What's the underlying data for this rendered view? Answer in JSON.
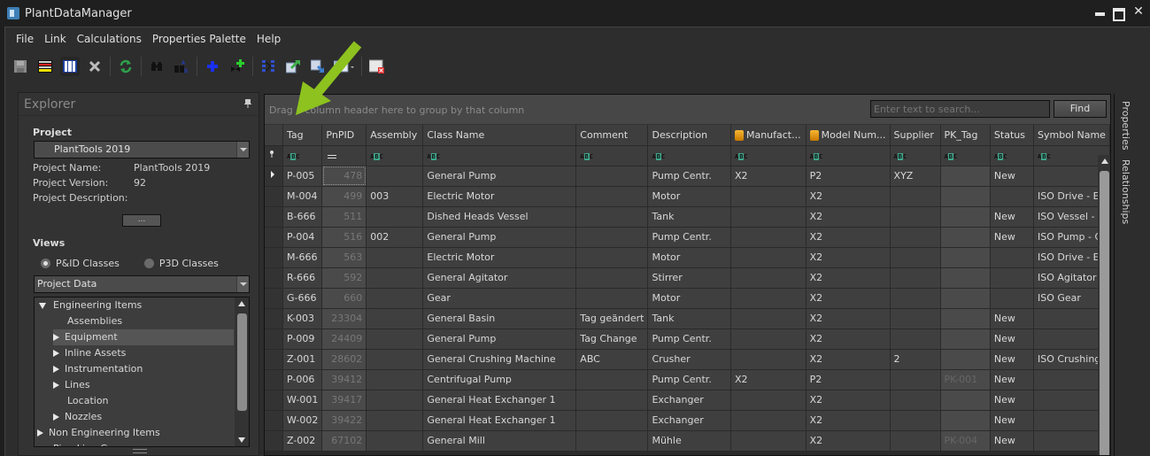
{
  "window": {
    "title": "PlantDataManager",
    "controls": [
      "minimize",
      "maximize",
      "close"
    ]
  },
  "menu": [
    "File",
    "Link",
    "Calculations",
    "Properties Palette",
    "Help"
  ],
  "toolbar": [
    {
      "name": "save-icon",
      "enabled": false
    },
    {
      "name": "color-rows-icon"
    },
    {
      "name": "columns-icon",
      "active": true
    },
    {
      "name": "delete-icon"
    },
    {
      "sep": true
    },
    {
      "name": "refresh-icon"
    },
    {
      "sep": true
    },
    {
      "name": "find-icon"
    },
    {
      "name": "find-replace-icon"
    },
    {
      "sep": true
    },
    {
      "name": "add-icon"
    },
    {
      "name": "add-valve-icon"
    },
    {
      "sep": true
    },
    {
      "name": "link-icon"
    },
    {
      "name": "export-icon"
    },
    {
      "name": "import-icon"
    },
    {
      "name": "table-view-dropdown-icon"
    },
    {
      "sep": true
    },
    {
      "name": "close-project-icon"
    }
  ],
  "explorer": {
    "title": "Explorer",
    "project_label": "Project",
    "project_selected": "PlantTools 2019",
    "project_name_label": "Project Name:",
    "project_name": "PlantTools 2019",
    "project_version_label": "Project Version:",
    "project_version": "92",
    "project_description_label": "Project Description:",
    "project_description": "",
    "ellipsis_button": "...",
    "views_label": "Views",
    "views": [
      {
        "label": "P&ID Classes",
        "checked": true
      },
      {
        "label": "P3D Classes",
        "checked": false
      }
    ],
    "data_selected": "Project Data",
    "tree": [
      {
        "label": "Engineering Items",
        "level": 0,
        "expander": "expanded"
      },
      {
        "label": "Assemblies",
        "level": 1,
        "expander": "none"
      },
      {
        "label": "Equipment",
        "level": 1,
        "expander": "collapsed",
        "selected": true
      },
      {
        "label": "Inline Assets",
        "level": 1,
        "expander": "collapsed"
      },
      {
        "label": "Instrumentation",
        "level": 1,
        "expander": "collapsed"
      },
      {
        "label": "Lines",
        "level": 1,
        "expander": "collapsed"
      },
      {
        "label": "Location",
        "level": 1,
        "expander": "none"
      },
      {
        "label": "Nozzles",
        "level": 1,
        "expander": "collapsed"
      },
      {
        "label": "Non Engineering Items",
        "level": 0,
        "expander": "collapsed"
      },
      {
        "label": "Pipe Line Group",
        "level": 0,
        "expander": "none"
      }
    ]
  },
  "grid": {
    "group_hint": "Drag a column header here to group by that column",
    "search_placeholder": "Enter text to search...",
    "find_label": "Find",
    "columns": [
      "Tag",
      "PnPID",
      "Assembly",
      "Class Name",
      "Comment",
      "Description",
      "Manufact...",
      "Model Num...",
      "Supplier",
      "PK_Tag",
      "Status",
      "Symbol Name"
    ],
    "rows": [
      [
        "P-005",
        "478",
        "",
        "General Pump",
        "",
        "Pump Centr.",
        "X2",
        "P2",
        "XYZ",
        "",
        "New",
        ""
      ],
      [
        "M-004",
        "499",
        "003",
        "Electric Motor",
        "",
        "Motor",
        "",
        "X2",
        "",
        "",
        "",
        "ISO Drive - E"
      ],
      [
        "B-666",
        "511",
        "",
        "Dished Heads Vessel",
        "",
        "Tank",
        "",
        "X2",
        "",
        "",
        "New",
        "ISO Vessel -"
      ],
      [
        "P-004",
        "516",
        "002",
        "General Pump",
        "",
        "Pump Centr.",
        "",
        "X2",
        "",
        "",
        "New",
        "ISO Pump - C"
      ],
      [
        "M-666",
        "563",
        "",
        "Electric Motor",
        "",
        "Motor",
        "",
        "X2",
        "",
        "",
        "",
        "ISO Drive - E"
      ],
      [
        "R-666",
        "592",
        "",
        "General Agitator",
        "",
        "Stirrer",
        "",
        "X2",
        "",
        "",
        "",
        "ISO Agitator"
      ],
      [
        "G-666",
        "660",
        "",
        "Gear",
        "",
        "Motor",
        "",
        "X2",
        "",
        "",
        "",
        "ISO Gear"
      ],
      [
        "K-003",
        "23304",
        "",
        "General Basin",
        "Tag geändert",
        "Tank",
        "",
        "X2",
        "",
        "",
        "New",
        ""
      ],
      [
        "P-009",
        "24409",
        "",
        "General Pump",
        "Tag Change",
        "Pump Centr.",
        "",
        "X2",
        "",
        "",
        "New",
        ""
      ],
      [
        "Z-001",
        "28602",
        "",
        "General Crushing Machine",
        "ABC",
        "Crusher",
        "",
        "X2",
        "2",
        "",
        "New",
        "ISO Crushing"
      ],
      [
        "P-006",
        "39412",
        "",
        "Centrifugal Pump",
        "",
        "Pump Centr.",
        "X2",
        "P2",
        "",
        "PK-001",
        "New",
        ""
      ],
      [
        "W-001",
        "39417",
        "",
        "General Heat Exchanger 1",
        "",
        "Exchanger",
        "",
        "X2",
        "",
        "",
        "New",
        ""
      ],
      [
        "W-002",
        "39422",
        "",
        "General Heat Exchanger 1",
        "",
        "Exchanger",
        "",
        "X2",
        "",
        "",
        "New",
        ""
      ],
      [
        "Z-002",
        "67102",
        "",
        "General Mill",
        "",
        "Mühle",
        "",
        "X2",
        "",
        "PK-004",
        "New",
        ""
      ]
    ]
  },
  "side_tabs": [
    "Properties",
    "Relationships"
  ],
  "colors": {
    "annotation_arrow": "#8dc21f",
    "filter_badge": "#3ea58a"
  }
}
